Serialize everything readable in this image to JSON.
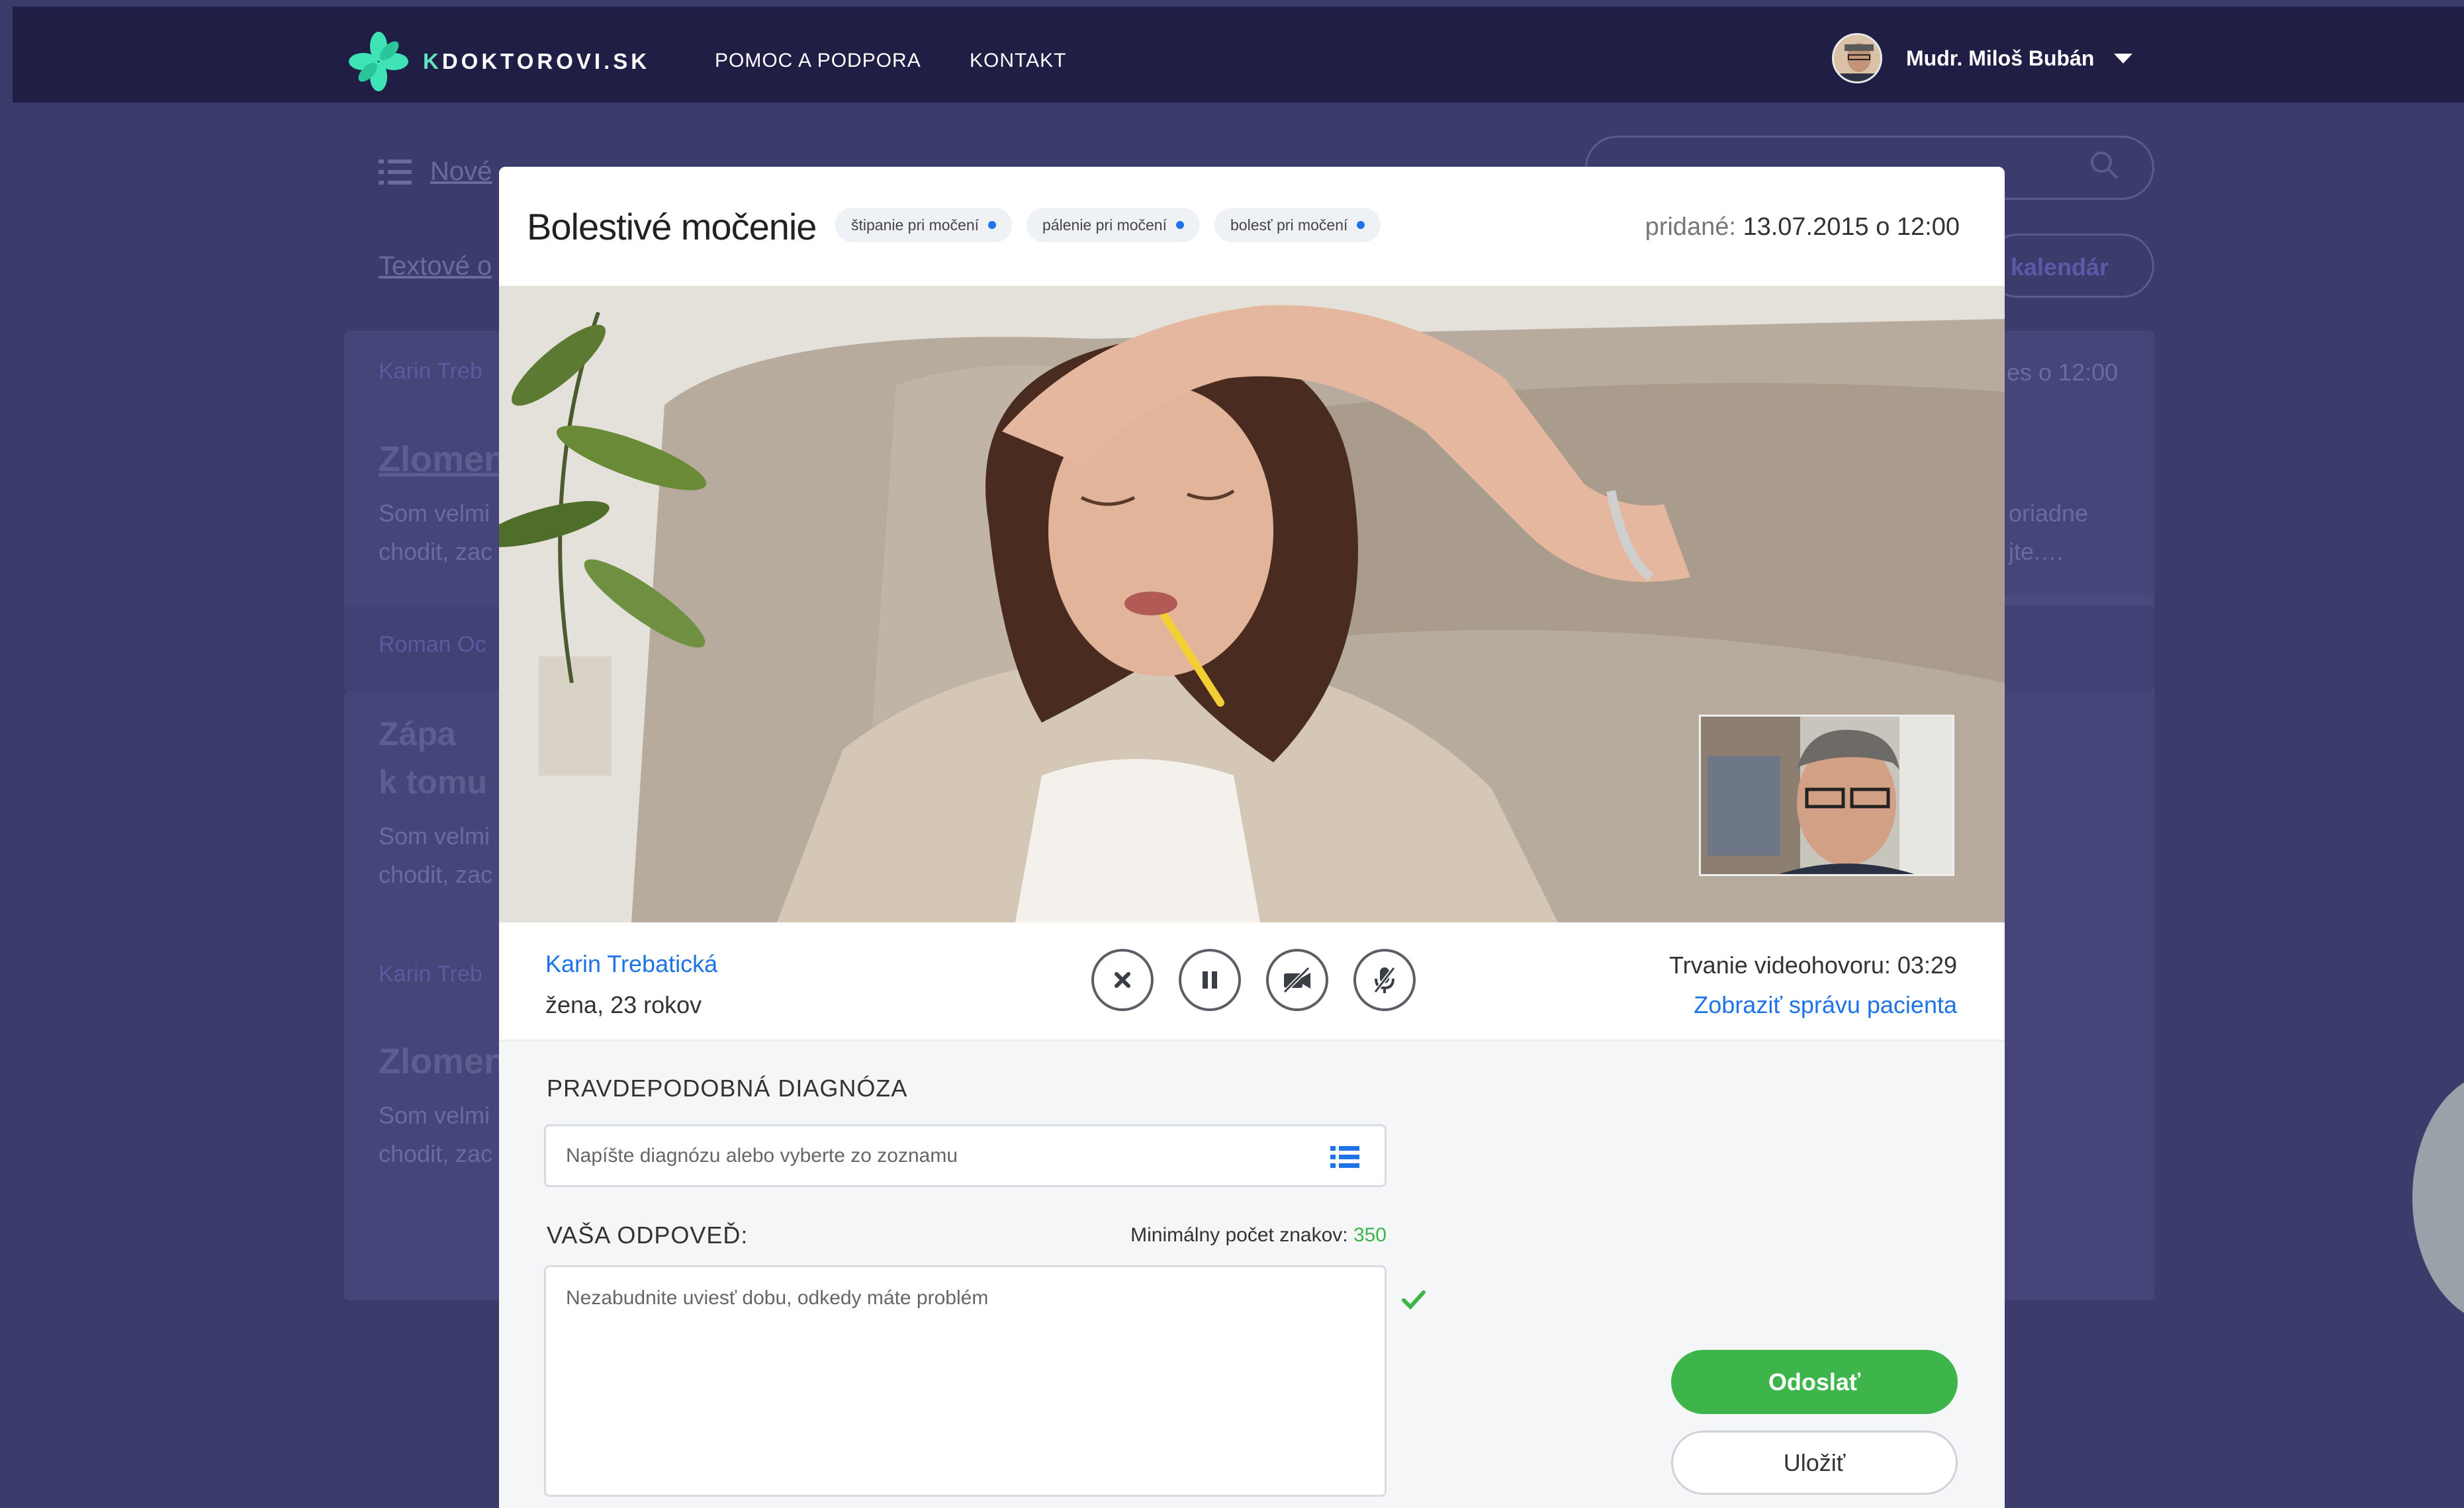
{
  "brand": {
    "logo_prefix": "K",
    "logo_rest": "DOKTOROVI.SK"
  },
  "nav": {
    "help": "POMOC A PODPORA",
    "contact": "KONTAKT"
  },
  "user": {
    "name": "Mudr. Miloš Bubán"
  },
  "background": {
    "tab_new": "Nové",
    "text_label": "Textové o",
    "calendar_btn": "kalendár",
    "card1_author": "Karin Treb",
    "card1_title": "Zlomen",
    "card1_text1": "Som velmi",
    "card1_text2": "chodit, zac",
    "card1_right1": "oriadne",
    "card1_right2": "jte.…",
    "card1_time": "es o 12:00",
    "card2_author": "Roman Oc",
    "card2_title1": "Zápa",
    "card2_title2": "k tomu",
    "card2_text1": "Som velmi",
    "card2_text2": "chodit, zac",
    "card3_author": "Karin Treb",
    "card3_title": "Zlomen",
    "card3_text1": "Som velmi",
    "card3_text2": "chodit, zac"
  },
  "modal": {
    "title": "Bolestivé močenie",
    "chips": [
      "štipanie pri močení",
      "pálenie pri močení",
      "bolesť pri močení"
    ],
    "added_label": "pridané:",
    "added_value": "13.07.2015 o 12:00"
  },
  "call": {
    "patient_name": "Karin Trebatická",
    "patient_info": "žena, 23 rokov",
    "duration_label": "Trvanie videohovoru:",
    "duration_value": "03:29",
    "show_report": "Zobraziť správu pacienta"
  },
  "form": {
    "diagnosis_label": "PRAVDEPODOBNÁ DIAGNÓZA",
    "diagnosis_placeholder": "Napíšte diagnózu alebo vyberte zo zoznamu",
    "answer_label": "VAŠA ODPOVEĎ:",
    "min_chars_label": "Minimálny počet znakov:",
    "min_chars_value": "350",
    "answer_placeholder": "Nezabudnite uviesť dobu, odkedy máte problém",
    "send": "Odoslať",
    "save": "Uložiť"
  }
}
